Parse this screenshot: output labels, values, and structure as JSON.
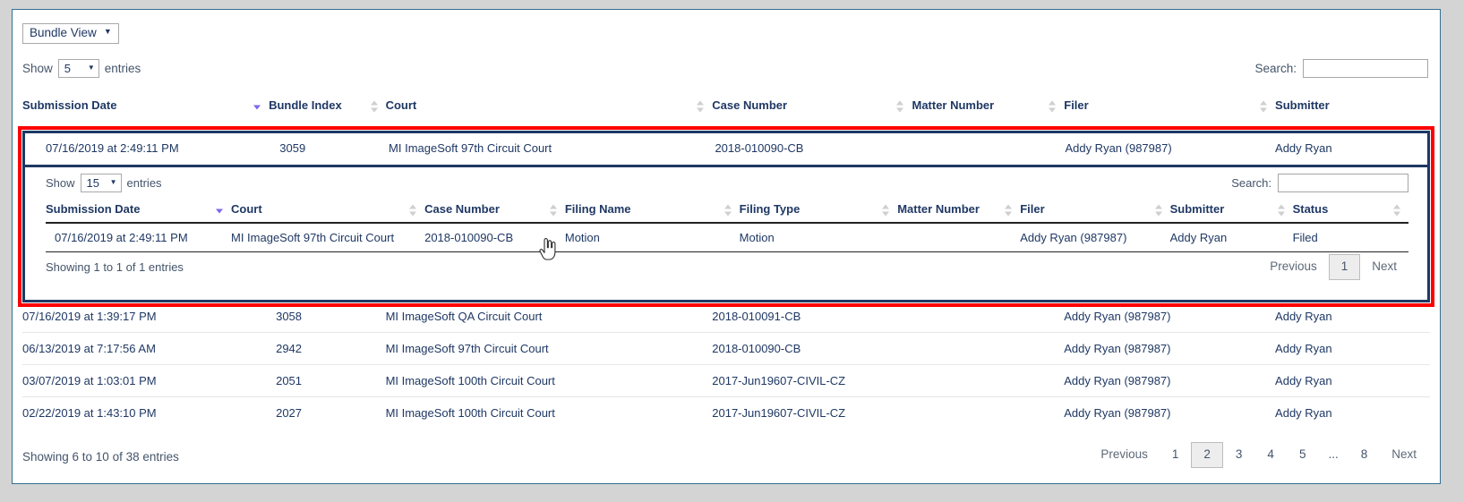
{
  "view_selector": {
    "label": "Bundle View",
    "caret": "chevron-down"
  },
  "outer_table": {
    "length_label_before": "Show",
    "length_value": "5",
    "length_label_after": "entries",
    "search_label": "Search:",
    "search_value": "",
    "search_placeholder": "",
    "columns": [
      {
        "label": "Submission Date",
        "sort": "desc"
      },
      {
        "label": "Bundle Index",
        "sort": "none"
      },
      {
        "label": "Court",
        "sort": "none"
      },
      {
        "label": "Case Number",
        "sort": "none"
      },
      {
        "label": "Matter Number",
        "sort": "none"
      },
      {
        "label": "Filer",
        "sort": "none"
      },
      {
        "label": "Submitter",
        "sort": "none"
      }
    ],
    "expanded_row": {
      "submission_date": "07/16/2019 at 2:49:11 PM",
      "bundle_index": "3059",
      "court": "MI ImageSoft 97th Circuit Court",
      "case_number": "2018-010090-CB",
      "matter_number": "",
      "filer": "Addy Ryan (987987)",
      "submitter": "Addy Ryan"
    },
    "rows": [
      {
        "submission_date": "07/16/2019 at 1:39:17 PM",
        "bundle_index": "3058",
        "court": "MI ImageSoft QA Circuit Court",
        "case_number": "2018-010091-CB",
        "matter_number": "",
        "filer": "Addy Ryan (987987)",
        "submitter": "Addy Ryan"
      },
      {
        "submission_date": "06/13/2019 at 7:17:56 AM",
        "bundle_index": "2942",
        "court": "MI ImageSoft 97th Circuit Court",
        "case_number": "2018-010090-CB",
        "matter_number": "",
        "filer": "Addy Ryan (987987)",
        "submitter": "Addy Ryan"
      },
      {
        "submission_date": "03/07/2019 at 1:03:01 PM",
        "bundle_index": "2051",
        "court": "MI ImageSoft 100th Circuit Court",
        "case_number": "2017-Jun19607-CIVIL-CZ",
        "matter_number": "",
        "filer": "Addy Ryan (987987)",
        "submitter": "Addy Ryan"
      },
      {
        "submission_date": "02/22/2019 at 1:43:10 PM",
        "bundle_index": "2027",
        "court": "MI ImageSoft 100th Circuit Court",
        "case_number": "2017-Jun19607-CIVIL-CZ",
        "matter_number": "",
        "filer": "Addy Ryan (987987)",
        "submitter": "Addy Ryan"
      }
    ],
    "info": "Showing 6 to 10 of 38 entries",
    "pagination": {
      "previous": "Previous",
      "pages": [
        "1",
        "2",
        "3",
        "4",
        "5",
        "...",
        "8"
      ],
      "current": "2",
      "next": "Next"
    }
  },
  "nested_table": {
    "length_label_before": "Show",
    "length_value": "15",
    "length_label_after": "entries",
    "search_label": "Search:",
    "search_value": "",
    "search_placeholder": "",
    "columns": [
      {
        "label": "Submission Date",
        "sort": "desc"
      },
      {
        "label": "Court",
        "sort": "none"
      },
      {
        "label": "Case Number",
        "sort": "none"
      },
      {
        "label": "Filing Name",
        "sort": "none"
      },
      {
        "label": "Filing Type",
        "sort": "none"
      },
      {
        "label": "Matter Number",
        "sort": "none"
      },
      {
        "label": "Filer",
        "sort": "none"
      },
      {
        "label": "Submitter",
        "sort": "none"
      },
      {
        "label": "Status",
        "sort": "none"
      }
    ],
    "rows": [
      {
        "submission_date": "07/16/2019 at 2:49:11 PM",
        "court": "MI ImageSoft 97th Circuit Court",
        "case_number": "2018-010090-CB",
        "filing_name": "Motion",
        "filing_type": "Motion",
        "matter_number": "",
        "filer": "Addy Ryan (987987)",
        "submitter": "Addy Ryan",
        "status": "Filed"
      }
    ],
    "info": "Showing 1 to 1 of 1 entries",
    "pagination": {
      "previous": "Previous",
      "pages": [
        "1"
      ],
      "current": "1",
      "next": "Next"
    }
  },
  "colors": {
    "highlight_outline": "#ff0000",
    "highlight_inner": "#1f3864",
    "panel_border": "#31708f",
    "text_primary": "#1f3864",
    "link": "#3c63b4",
    "page_background": "#d4d4d4"
  }
}
